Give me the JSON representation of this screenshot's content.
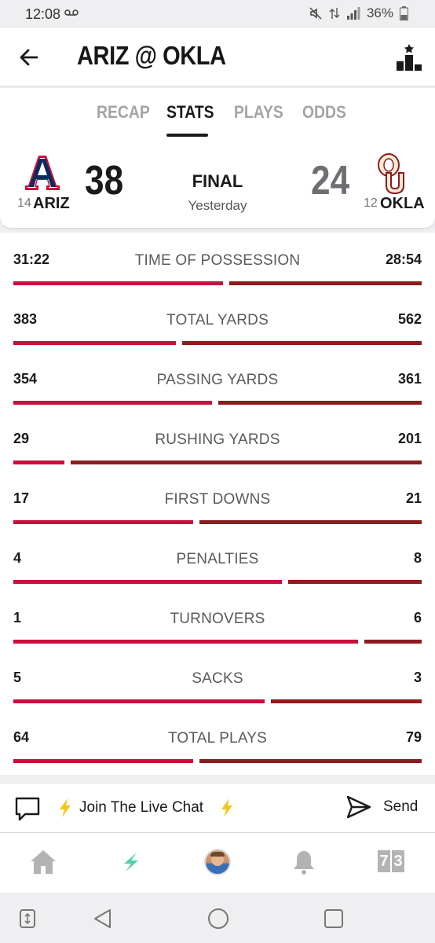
{
  "status_bar": {
    "time": "12:08",
    "battery": "36%"
  },
  "header": {
    "title": "ARIZ @ OKLA"
  },
  "tabs": [
    {
      "label": "RECAP",
      "active": false
    },
    {
      "label": "STATS",
      "active": true
    },
    {
      "label": "PLAYS",
      "active": false
    },
    {
      "label": "ODDS",
      "active": false
    }
  ],
  "scoreboard": {
    "away": {
      "rank": "14",
      "abbr": "ARIZ",
      "score": "38"
    },
    "home": {
      "rank": "12",
      "abbr": "OKLA",
      "score": "24"
    },
    "status": "FINAL",
    "date": "Yesterday"
  },
  "stats": [
    {
      "label": "TIME OF POSSESSION",
      "away": "31:22",
      "home": "28:54",
      "away_share": 0.521
    },
    {
      "label": "TOTAL YARDS",
      "away": "383",
      "home": "562",
      "away_share": 0.405
    },
    {
      "label": "PASSING YARDS",
      "away": "354",
      "home": "361",
      "away_share": 0.495
    },
    {
      "label": "RUSHING YARDS",
      "away": "29",
      "home": "201",
      "away_share": 0.126
    },
    {
      "label": "FIRST DOWNS",
      "away": "17",
      "home": "21",
      "away_share": 0.447
    },
    {
      "label": "PENALTIES",
      "away": "4",
      "home": "8",
      "away_share": 0.667
    },
    {
      "label": "TURNOVERS",
      "away": "1",
      "home": "6",
      "away_share": 0.857
    },
    {
      "label": "SACKS",
      "away": "5",
      "home": "3",
      "away_share": 0.625
    },
    {
      "label": "TOTAL PLAYS",
      "away": "64",
      "home": "79",
      "away_share": 0.448
    }
  ],
  "colors": {
    "away_bar": "#c8103e",
    "home_bar": "#8c1c1d",
    "accent_bolt": "#f5c518",
    "nav_active": "#4fd1a1"
  },
  "chat": {
    "label": "Join The Live Chat",
    "send_label": "Send"
  },
  "bottom_nav": {
    "items": [
      "home-icon",
      "bolt-icon",
      "avatar",
      "bell-icon",
      "scoreboard-icon"
    ],
    "counter": [
      "7",
      "3"
    ]
  }
}
